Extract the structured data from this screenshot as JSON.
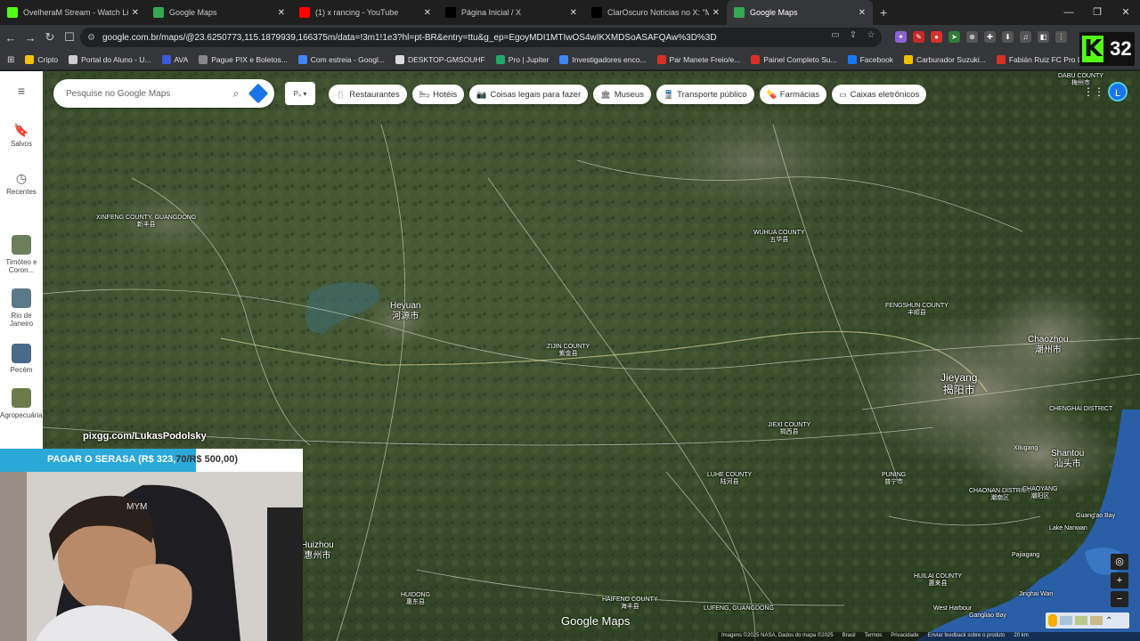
{
  "browser": {
    "tabs": [
      {
        "title": "OvelheraM Stream - Watch Live on K",
        "icon": "kick-icon",
        "color": "#53fc18"
      },
      {
        "title": "Google Maps",
        "icon": "maps-icon",
        "color": "#34a853"
      },
      {
        "title": "(1) x rancing - YouTube",
        "icon": "youtube-icon",
        "color": "#ff0000"
      },
      {
        "title": "Página Inicial / X",
        "icon": "x-icon",
        "color": "#000000"
      },
      {
        "title": "ClarOscuro Notícias no X: \"Mientras",
        "icon": "x-icon",
        "color": "#000000"
      },
      {
        "title": "Google Maps",
        "icon": "maps-icon",
        "color": "#34a853",
        "active": true
      }
    ],
    "url": "google.com.br/maps/@23.6250773,115.1879939,166375m/data=!3m1!1e3?hl=pt-BR&entry=ttu&g_ep=EgoyMDI1MTIwOS4wIKXMDSoASAFQAw%3D%3D",
    "bookmarks": [
      {
        "label": "Cripto",
        "color": "#f4c20d"
      },
      {
        "label": "Portal do Aluno - U...",
        "color": "#cccccc"
      },
      {
        "label": "AVA",
        "color": "#3b5bdb"
      },
      {
        "label": "Pague PIX e Boletos...",
        "color": "#888888"
      },
      {
        "label": "Com estreia - Googl...",
        "color": "#4285f4"
      },
      {
        "label": "DESKTOP-GMSOUHF",
        "color": "#dddddd"
      },
      {
        "label": "Pro | Jupiter",
        "color": "#22aa66"
      },
      {
        "label": "Investigadores enco...",
        "color": "#4285f4"
      },
      {
        "label": "Par Manete Freio/e...",
        "color": "#d93025"
      },
      {
        "label": "Painel Completo Su...",
        "color": "#d93025"
      },
      {
        "label": "Facebook",
        "color": "#1877f2"
      },
      {
        "label": "Carburador Suzuki...",
        "color": "#f0c000"
      },
      {
        "label": "Fabián Ruiz FC Pro L...",
        "color": "#d93025"
      }
    ],
    "kick_count": "32"
  },
  "maps": {
    "search_placeholder": "Pesquise no Google Maps",
    "layer_label": "P₄",
    "rail": [
      {
        "label": "Salvos",
        "icon": "bookmark-icon"
      },
      {
        "label": "Recentes",
        "icon": "history-icon"
      },
      {
        "label": "Timóteo e Coron...",
        "icon": "thumb"
      },
      {
        "label": "Rio de Janeiro",
        "icon": "thumb"
      },
      {
        "label": "Pecém",
        "icon": "thumb"
      },
      {
        "label": "Agropecuária...",
        "icon": "thumb"
      }
    ],
    "chips": [
      {
        "label": "Restaurantes",
        "icon": "fork-icon"
      },
      {
        "label": "Hotéis",
        "icon": "bed-icon"
      },
      {
        "label": "Coisas legais para fazer",
        "icon": "camera-icon"
      },
      {
        "label": "Museus",
        "icon": "museum-icon"
      },
      {
        "label": "Transporte público",
        "icon": "train-icon"
      },
      {
        "label": "Farmácias",
        "icon": "pharmacy-icon"
      },
      {
        "label": "Caixas eletrônicos",
        "icon": "atm-icon"
      }
    ],
    "avatar_letter": "L",
    "logo": "Google Maps",
    "attribution": [
      "Imagens ©2025 NASA, Dados do mapa ©2025",
      "Brasil",
      "Termos",
      "Privacidade",
      "Enviar feedback sobre o produto",
      "20 km"
    ],
    "places": {
      "xinfeng": {
        "en": "XINFENG COUNTY, GUANGDONG",
        "cn": "新丰县"
      },
      "heyuan": {
        "en": "Heyuan",
        "cn": "河源市"
      },
      "zijin": {
        "en": "ZIJIN COUNTY",
        "cn": "紫金县"
      },
      "wuhua": {
        "en": "WUHUA COUNTY",
        "cn": "五华县"
      },
      "fengshun": {
        "en": "FENGSHUN COUNTY",
        "cn": "丰顺县"
      },
      "jieyang": {
        "en": "Jieyang",
        "cn": "揭阳市"
      },
      "chaozhou": {
        "en": "Chaozhou",
        "cn": "潮州市"
      },
      "jiexi": {
        "en": "JIEXI COUNTY",
        "cn": "揭西县"
      },
      "luhe": {
        "en": "LUHE COUNTY",
        "cn": "陆河县"
      },
      "puning": {
        "en": "PUNING",
        "cn": "普宁市"
      },
      "chaonan": {
        "en": "CHAONAN DISTRICT",
        "cn": "潮南区"
      },
      "chaoyang": {
        "en": "CHAOYANG",
        "cn": "潮阳区"
      },
      "shantou": {
        "en": "Shantou",
        "cn": "汕头市"
      },
      "chenghai": {
        "en": "CHENGHAI DISTRICT",
        "cn": ""
      },
      "huidong": {
        "en": "HUIDONG",
        "cn": "惠东县"
      },
      "haifeng": {
        "en": "HAIFENG COUNTY",
        "cn": "海丰县"
      },
      "lufeng": {
        "en": "LUFENG, GUANGDONG",
        "cn": ""
      },
      "huilai": {
        "en": "HUILAI COUNTY",
        "cn": "惠来县"
      },
      "huizhou": {
        "en": "Huizhou",
        "cn": "惠州市"
      },
      "dabu": {
        "en": "DABU COUNTY",
        "cn": "梅州市"
      },
      "xilugang": {
        "en": "Xilugang",
        "cn": ""
      },
      "guangaobay": {
        "en": "Guang'ao Bay",
        "cn": ""
      },
      "lakenanwan": {
        "en": "Lake Nanwan",
        "cn": ""
      },
      "jinghaiwan": {
        "en": "Jinghai Wan",
        "cn": ""
      },
      "westharbour": {
        "en": "West Harbour",
        "cn": ""
      },
      "ganglia": {
        "en": "Gangliao Bay",
        "cn": ""
      },
      "pajiagang": {
        "en": "Pajiagang",
        "cn": ""
      }
    }
  },
  "stream": {
    "pix": "pixgg.com/LukasPodolsky",
    "goal_prefix": "PAGAR O SERASA (R$ 323,",
    "goal_suffix": "70/R$ 500,00)",
    "goal_fraction": 0.647
  }
}
